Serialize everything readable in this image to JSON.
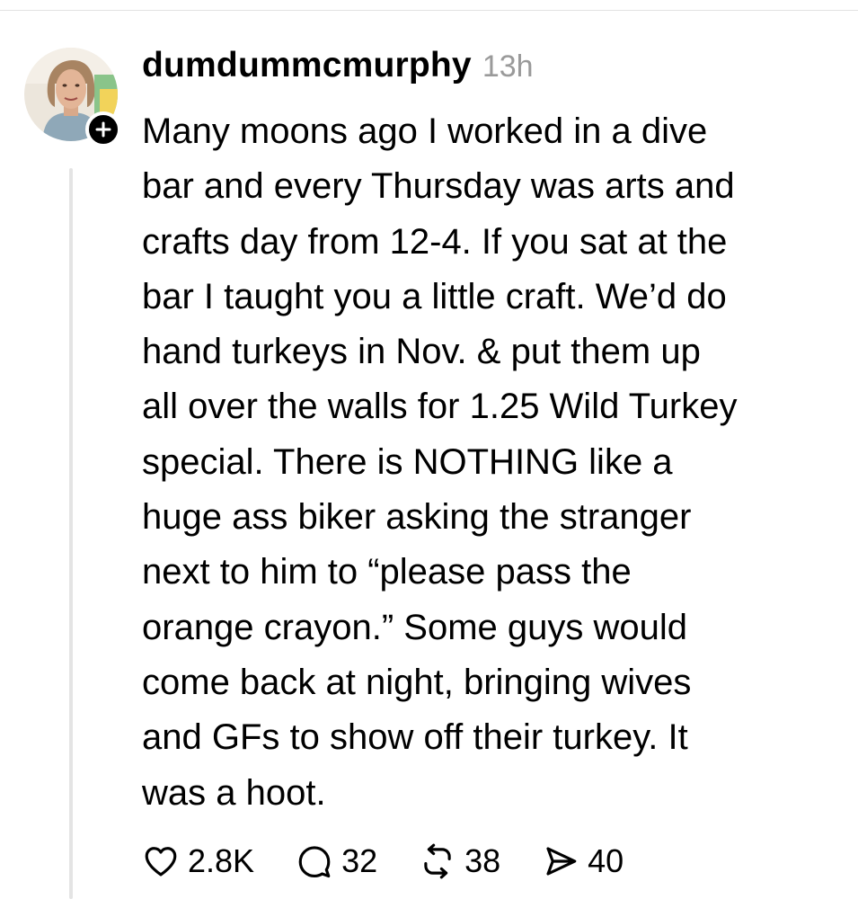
{
  "post": {
    "username": "dumdummcmurphy",
    "timestamp": "13h",
    "lines": [
      "Many moons ago I worked in a dive",
      "bar and every Thursday was arts and",
      "crafts day from 12-4. If you sat at the",
      "bar I taught you a little craft. We’d do",
      "hand turkeys in Nov. & put them up",
      "all over the walls for 1.25 Wild Turkey",
      "special. There is NOTHING like a",
      "huge ass biker asking the stranger",
      "next to him to “please pass the",
      "orange crayon.” Some guys would",
      "come back at night, bringing wives",
      "and GFs to show off their turkey. It",
      "was a hoot."
    ]
  },
  "actions": {
    "like": {
      "icon": "heart-icon",
      "count": "2.8K"
    },
    "reply": {
      "icon": "comment-icon",
      "count": "32"
    },
    "repost": {
      "icon": "repost-icon",
      "count": "38"
    },
    "share": {
      "icon": "send-icon",
      "count": "40"
    }
  },
  "icons": {
    "follow": "plus-icon"
  },
  "colors": {
    "text": "#000000",
    "timestamp": "#9a9a9a",
    "thread_line": "#e4e4e4",
    "badge": "#000000"
  }
}
